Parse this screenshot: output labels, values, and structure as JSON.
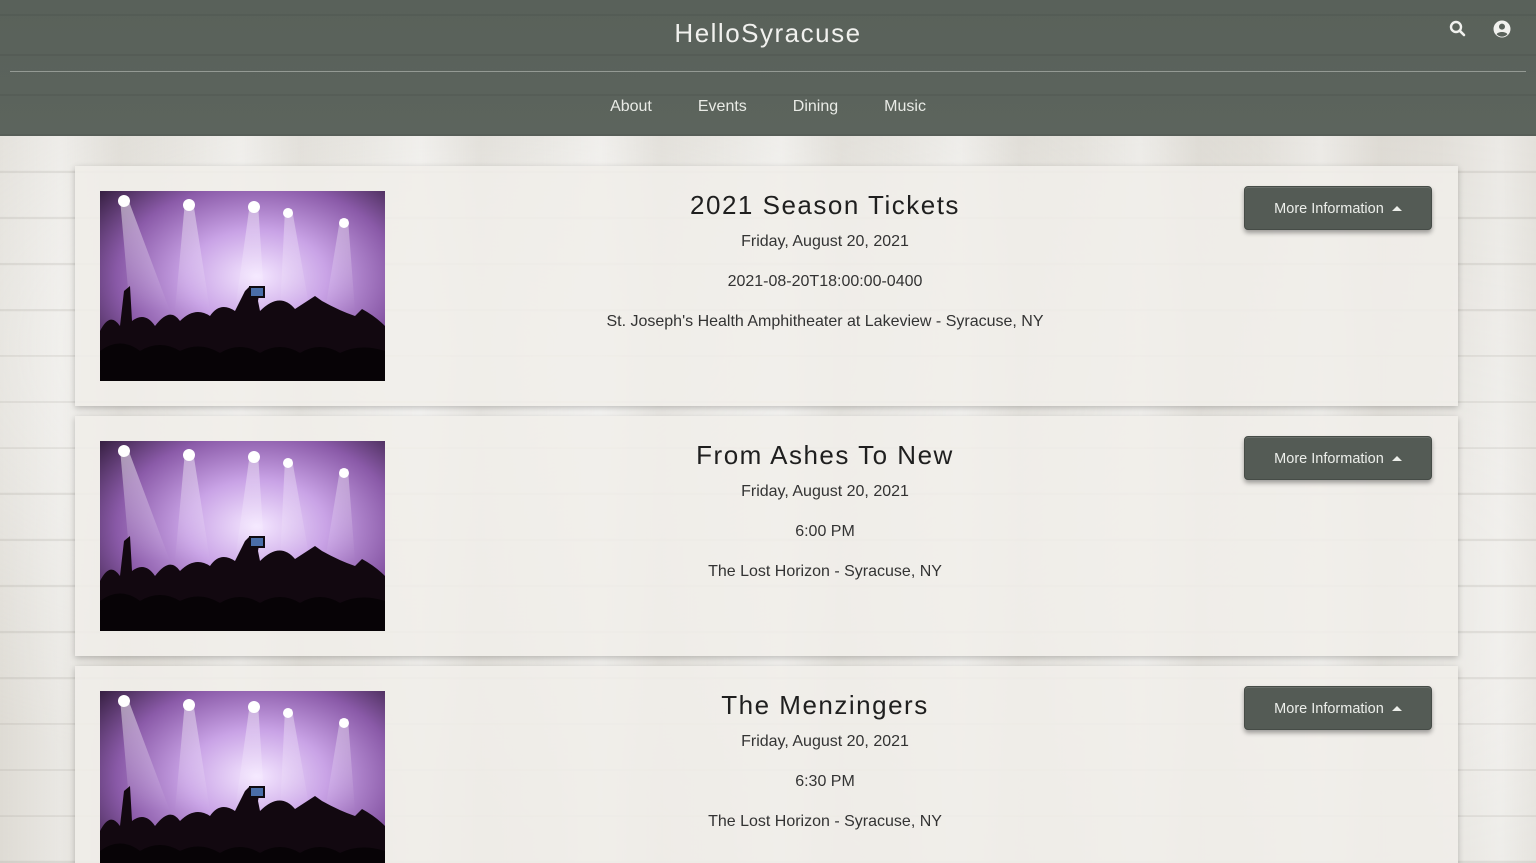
{
  "header": {
    "brand_light": "Hello",
    "brand_bold": "Syracuse",
    "nav": [
      "About",
      "Events",
      "Dining",
      "Music"
    ],
    "icons": [
      "search-icon",
      "user-circle-icon"
    ]
  },
  "events": [
    {
      "title": "2021 Season Tickets",
      "date": "Friday, August 20, 2021",
      "time": "2021-08-20T18:00:00-0400",
      "venue": "St. Joseph's Health Amphitheater at Lakeview - Syracuse, NY",
      "button": "More Information"
    },
    {
      "title": "From Ashes To New",
      "date": "Friday, August 20, 2021",
      "time": "6:00 PM",
      "venue": "The Lost Horizon - Syracuse, NY",
      "button": "More Information"
    },
    {
      "title": "The Menzingers",
      "date": "Friday, August 20, 2021",
      "time": "6:30 PM",
      "venue": "The Lost Horizon - Syracuse, NY",
      "button": "More Information"
    }
  ],
  "colors": {
    "header_bg": "#5a625b",
    "button_bg": "#545b55",
    "card_bg": "#f0eee9"
  }
}
